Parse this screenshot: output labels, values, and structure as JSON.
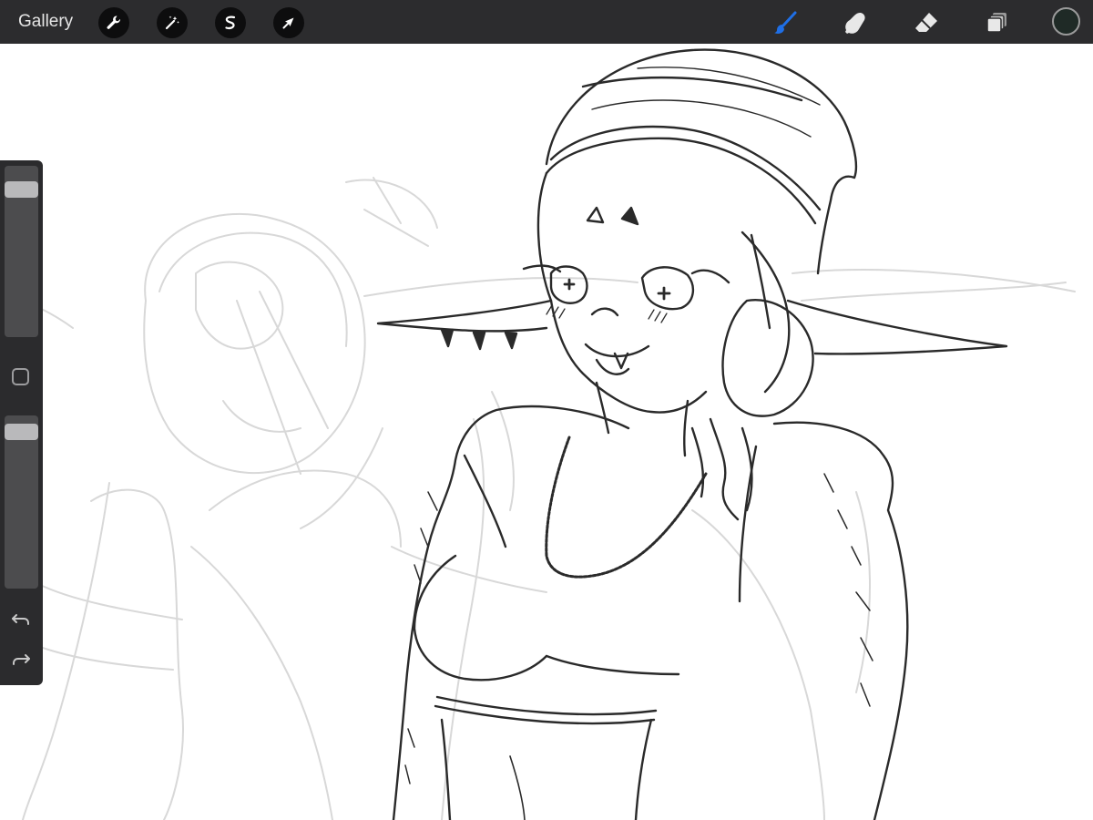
{
  "topbar": {
    "gallery_label": "Gallery",
    "left_tools": [
      {
        "name": "actions",
        "icon": "wrench-icon"
      },
      {
        "name": "adjustments",
        "icon": "magic-wand-icon"
      },
      {
        "name": "selection",
        "icon": "selection-s-icon"
      },
      {
        "name": "transform",
        "icon": "arrow-cursor-icon"
      }
    ],
    "right_tools": [
      {
        "name": "brush",
        "icon": "brush-icon",
        "active": true
      },
      {
        "name": "smudge",
        "icon": "smudge-finger-icon",
        "active": false
      },
      {
        "name": "eraser",
        "icon": "eraser-icon",
        "active": false
      },
      {
        "name": "layers",
        "icon": "layers-icon",
        "active": false
      }
    ],
    "current_color": "#1f2a26"
  },
  "sidebar": {
    "brush_size_level": 0.9,
    "opacity_level": 0.95,
    "modify_icon": "square-modify-icon",
    "undo_icon": "undo-icon",
    "redo_icon": "redo-icon"
  },
  "colors": {
    "toolbar_bg": "#2c2c2e",
    "active_tool": "#1f6fe6",
    "inactive_tool": "#e8e8e8",
    "sketch_ink": "#2a2a2a",
    "sketch_light": "#d6d6d6"
  }
}
